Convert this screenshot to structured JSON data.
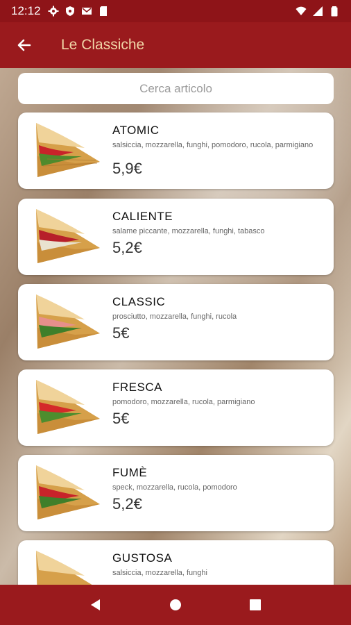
{
  "status_bar": {
    "time": "12:12",
    "icons_left": [
      "gear-icon",
      "shield-icon",
      "gmail-icon",
      "sd-card-icon"
    ],
    "icons_right": [
      "wifi-icon",
      "signal-icon",
      "battery-icon"
    ]
  },
  "app_bar": {
    "title": "Le Classiche",
    "back_icon": "arrow-left-icon",
    "title_color": "#f1d6a8",
    "background": "#9a1a1d"
  },
  "search": {
    "placeholder": "Cerca articolo"
  },
  "items": [
    {
      "name": "ATOMIC",
      "ingredients": "salsiccia, mozzarella, funghi, pomodoro, rucola, parmigiano",
      "price": "5,9€"
    },
    {
      "name": "CALIENTE",
      "ingredients": "salame piccante, mozzarella, funghi, tabasco",
      "price": "5,2€"
    },
    {
      "name": "CLASSIC",
      "ingredients": "prosciutto, mozzarella, funghi, rucola",
      "price": "5€"
    },
    {
      "name": "FRESCA",
      "ingredients": "pomodoro, mozzarella, rucola, parmigiano",
      "price": "5€"
    },
    {
      "name": "FUMÈ",
      "ingredients": "speck, mozzarella, rucola, pomodoro",
      "price": "5,2€"
    },
    {
      "name": "GUSTOSA",
      "ingredients": "salsiccia, mozzarella, funghi",
      "price": ""
    }
  ],
  "nav_bar": {
    "buttons": [
      "back-triangle-icon",
      "home-circle-icon",
      "recents-square-icon"
    ]
  }
}
